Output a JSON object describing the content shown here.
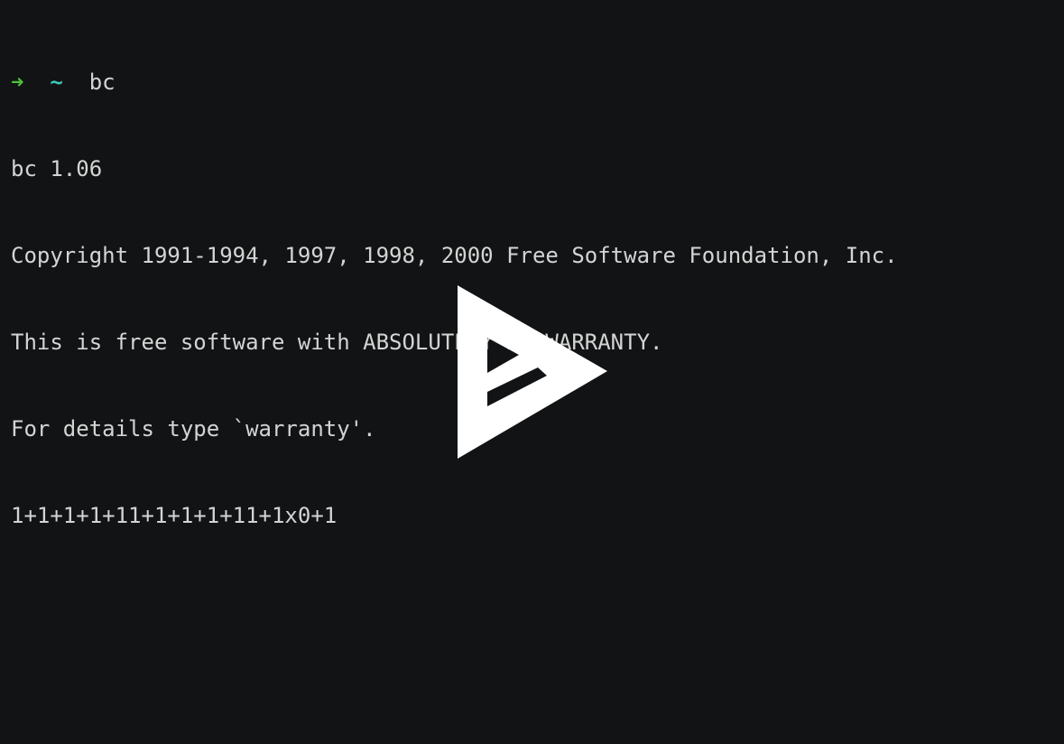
{
  "terminal": {
    "prompt": {
      "arrow": "➜",
      "dir": "~",
      "command": "bc"
    },
    "output": [
      "bc 1.06",
      "Copyright 1991-1994, 1997, 1998, 2000 Free Software Foundation, Inc.",
      "This is free software with ABSOLUTELY NO WARRANTY.",
      "For details type `warranty'.",
      "1+1+1+1+11+1+1+1+11+1x0+1"
    ]
  },
  "colors": {
    "background": "#121314",
    "text": "#d4d4d4",
    "prompt_arrow": "#4ec13a",
    "prompt_dir": "#3cc8b4",
    "play_icon": "#ffffff"
  },
  "overlay": {
    "icon": "asciinema-play-icon"
  }
}
